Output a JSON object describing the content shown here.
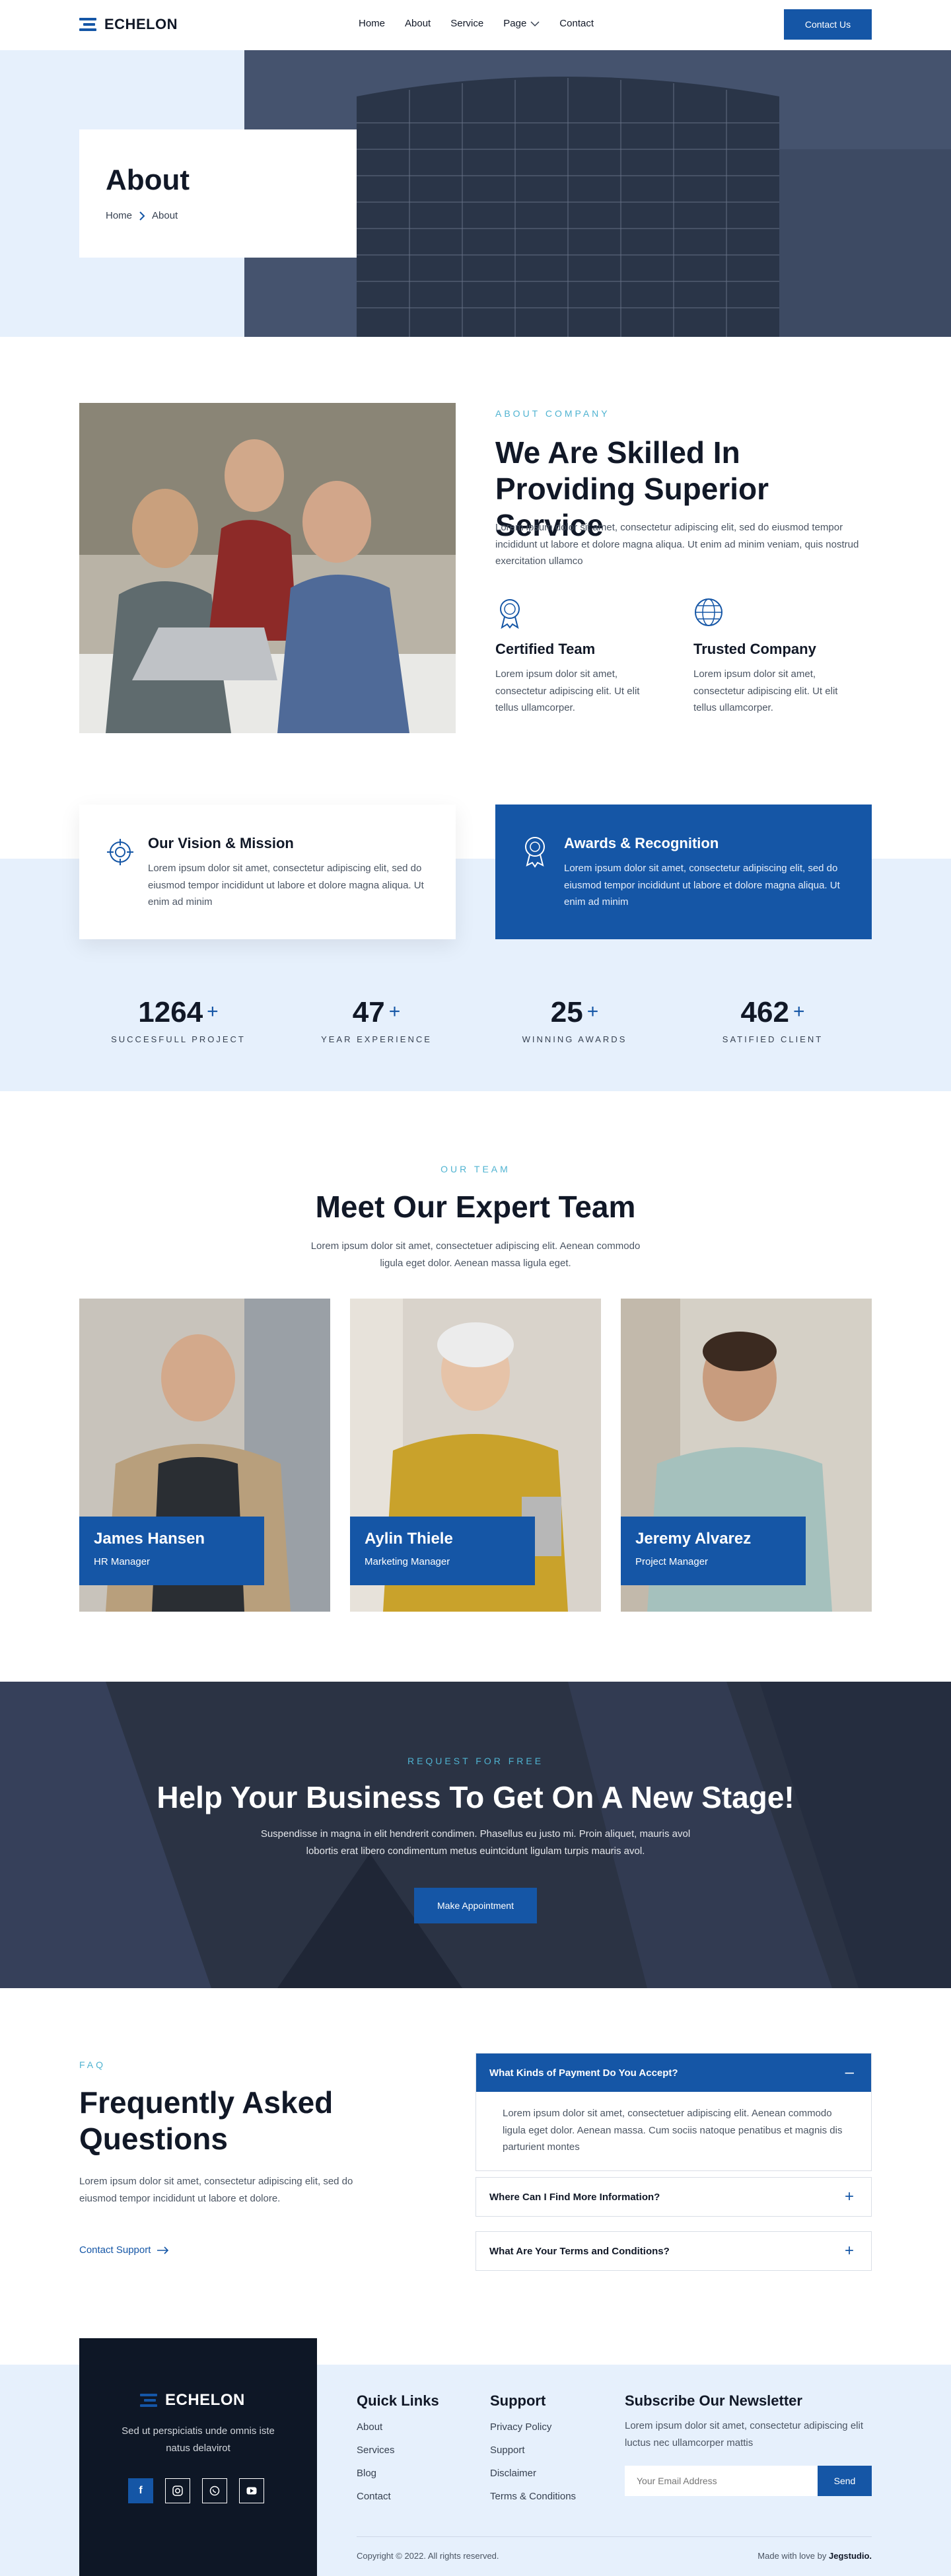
{
  "brand": {
    "name": "ECHELON",
    "accent": "#1556a6",
    "secondary_accent": "#4fb3d1"
  },
  "header": {
    "nav": [
      "Home",
      "About",
      "Service",
      "Page",
      "Contact"
    ],
    "cta_label": "Contact Us"
  },
  "hero": {
    "title": "About",
    "breadcrumb": [
      "Home",
      "About"
    ]
  },
  "about": {
    "eyebrow": "ABOUT COMPANY",
    "title": "We Are Skilled In Providing Superior Service",
    "text": "Lorem ipsum dolor sit amet, consectetur adipiscing elit, sed do eiusmod tempor incididunt ut labore et dolore magna aliqua. Ut enim ad minim veniam, quis nostrud exercitation ullamco",
    "features": [
      {
        "icon": "certificate-badge-icon",
        "title": "Certified Team",
        "text": "Lorem ipsum dolor sit amet, consectetur adipiscing elit. Ut elit tellus ullamcorper."
      },
      {
        "icon": "globe-network-icon",
        "title": "Trusted Company",
        "text": "Lorem ipsum dolor sit amet, consectetur adipiscing elit. Ut elit tellus ullamcorper."
      }
    ]
  },
  "vision": {
    "title": "Our Vision & Mission",
    "text": "Lorem ipsum dolor sit amet, consectetur adipiscing elit, sed do eiusmod tempor incididunt ut labore et dolore magna aliqua. Ut enim ad minim"
  },
  "awards": {
    "title": "Awards & Recognition",
    "text": "Lorem ipsum dolor sit amet, consectetur adipiscing elit, sed do eiusmod tempor incididunt ut labore et dolore magna aliqua. Ut enim ad minim"
  },
  "stats": [
    {
      "value": "1264",
      "label": "SUCCESFULL PROJECT"
    },
    {
      "value": "47",
      "label": "YEAR EXPERIENCE"
    },
    {
      "value": "25",
      "label": "WINNING AWARDS"
    },
    {
      "value": "462",
      "label": "SATIFIED CLIENT"
    }
  ],
  "team": {
    "eyebrow": "OUR TEAM",
    "title": "Meet Our Expert Team",
    "text": "Lorem ipsum dolor sit amet, consectetuer adipiscing elit. Aenean commodo ligula eget dolor. Aenean massa ligula eget.",
    "members": [
      {
        "name": "James Hansen",
        "role": "HR Manager"
      },
      {
        "name": "Aylin Thiele",
        "role": "Marketing Manager"
      },
      {
        "name": "Jeremy Alvarez",
        "role": "Project Manager"
      }
    ]
  },
  "cta": {
    "eyebrow": "REQUEST FOR FREE",
    "title": "Help Your Business To Get On A New Stage!",
    "text": "Suspendisse in magna in elit hendrerit condimen. Phasellus eu justo mi. Proin aliquet, mauris avol lobortis erat libero condimentum metus euintcidunt ligulam turpis mauris avol.",
    "button": "Make Appointment"
  },
  "faq": {
    "eyebrow": "FAQ",
    "title": "Frequently Asked Questions",
    "text": "Lorem ipsum dolor sit amet, consectetur adipiscing elit, sed do eiusmod tempor incididunt ut labore et dolore.",
    "link": "Contact Support",
    "items": [
      {
        "q": "What Kinds of Payment Do You Accept?",
        "a": "Lorem ipsum dolor sit amet, consectetuer adipiscing elit. Aenean commodo ligula eget dolor. Aenean massa. Cum sociis natoque penatibus et magnis dis parturient montes"
      },
      {
        "q": "Where Can I Find More Information?"
      },
      {
        "q": "What Are Your Terms and Conditions?"
      }
    ]
  },
  "footer": {
    "tagline": "Sed ut perspiciatis unde omnis iste natus delavirot",
    "quick_links_title": "Quick Links",
    "quick_links": [
      "About",
      "Services",
      "Blog",
      "Contact"
    ],
    "support_title": "Support",
    "support_links": [
      "Privacy Policy",
      "Support",
      "Disclaimer",
      "Terms & Conditions"
    ],
    "newsletter_title": "Subscribe Our Newsletter",
    "newsletter_text": "Lorem ipsum dolor sit amet, consectetur adipiscing elit luctus nec ullamcorper mattis",
    "email_placeholder": "Your Email Address",
    "send_label": "Send",
    "copyright": "Copyright © 2022. All rights reserved.",
    "made_with": "Made with love by",
    "studio": "Jegstudio."
  }
}
